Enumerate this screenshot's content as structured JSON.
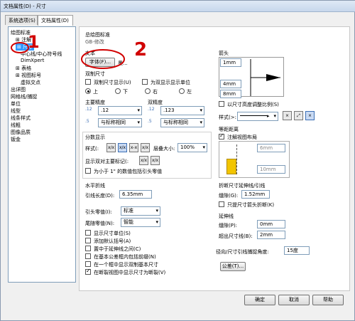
{
  "window": {
    "title": "文档属性(D) - 尺寸"
  },
  "tabs": [
    {
      "label": "系统选项(S)"
    },
    {
      "label": "文档属性(D)"
    }
  ],
  "tree": {
    "items": [
      {
        "label": "绘图标准"
      },
      {
        "label": "注解"
      },
      {
        "label": "尺寸"
      },
      {
        "label": "中心线/中心符号线"
      },
      {
        "label": "DimXpert"
      },
      {
        "label": "表格"
      },
      {
        "label": "视图标号"
      },
      {
        "label": "虚拟交点"
      },
      {
        "label": "出详图"
      },
      {
        "label": "网格线/捕捉"
      },
      {
        "label": "单位"
      },
      {
        "label": "线型"
      },
      {
        "label": "线条样式"
      },
      {
        "label": "线粗"
      },
      {
        "label": "图像品质"
      },
      {
        "label": "钣金"
      }
    ]
  },
  "main": {
    "standard_title": "总绘图标准",
    "standard_value": "GB-修改",
    "text_label": "文本",
    "font_button": "字体(F)...",
    "font_name": "黑...",
    "dual_title": "双制尺寸",
    "dual_display": "双制尺寸显示(U)",
    "dual_units": "为双显示显示单位",
    "dual_pos": [
      "上",
      "下",
      "右",
      "左"
    ],
    "primary_precision_title": "主要精度",
    "dual_precision_title": "双精度",
    "primary_value": ".12",
    "primary_tolerance": "与标称相同",
    "dual_value": ".123",
    "dual_tolerance": "与标称相同",
    "fraction_title": "分数显示",
    "style_label": "样式(:",
    "stack_size_label": "层叠大小:",
    "stack_size_value": "100%",
    "double_mark_label": "显示双对主要标记(:",
    "zero_feet": "为小于 1\" 的数值包括引头零值",
    "horiz_title": "水平折线",
    "leader_length_label": "引线长度(D):",
    "leader_length_value": "6.35mm",
    "lead_zero_label": "引头零值(I):",
    "lead_zero_value": "标准",
    "trail_zero_label": "尾随零值(N):",
    "trail_zero_value": "智能",
    "options": [
      "显示尺寸单位(S)",
      "添加默认括号(A)",
      "置中于延伸线之间(C)",
      "在基本公差框内包括前缀(N)",
      "在一个框中显示双制基本尺寸",
      "在断裂视图中显示尺寸为断裂(V)"
    ]
  },
  "arrows": {
    "title": "箭头",
    "field1": "1mm",
    "field2": "4mm",
    "field3": "8mm",
    "scale_label": "以尺寸高度调整比例(S)",
    "style_label": "样式(>:"
  },
  "offset": {
    "title": "等距距离",
    "use_doc": "注解视图布局",
    "v1": "6mm",
    "v2": "10mm"
  },
  "break": {
    "title": "折断尺寸延伸线/引线",
    "gap_label": "缝隙(G):",
    "gap_value": "1.52mm",
    "only_arrow": "只提尺寸箭头折断(K)"
  },
  "ext": {
    "title": "延伸线",
    "gap_label": "缝隙(P):",
    "gap_value": "0mm",
    "beyond_label": "超出尺寸线(B):",
    "beyond_value": "2mm"
  },
  "radial": {
    "label": "径向/尺寸引线捕捉角度:",
    "value": "15度"
  },
  "tolerance_button": "公差(T)...",
  "dialog": {
    "ok": "确定",
    "cancel": "取消",
    "help": "帮助"
  },
  "annotations": {
    "mark1": "1",
    "mark2": "2"
  }
}
